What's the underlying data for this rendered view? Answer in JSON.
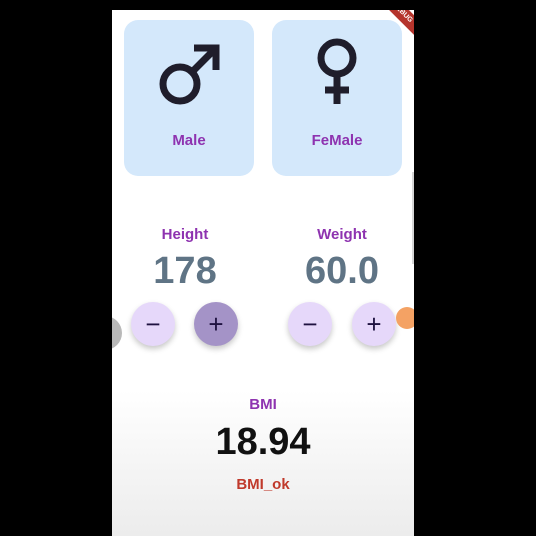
{
  "debug_banner": "DEBUG",
  "gender": {
    "male_label": "Male",
    "female_label": "FeMale"
  },
  "height": {
    "label": "Height",
    "value": "178"
  },
  "weight": {
    "label": "Weight",
    "value": "60.0"
  },
  "controls": {
    "minus_glyph": "−",
    "plus_glyph": "+"
  },
  "bmi": {
    "label": "BMI",
    "value": "18.94",
    "status": "BMI_ok"
  },
  "colors": {
    "card_bg": "#d4e8fb",
    "accent_purple": "#8e33b0",
    "value_slate": "#5f7485",
    "status_red": "#c0392b",
    "button_bg": "#e6d8fa",
    "button_pressed": "#a493c7"
  },
  "icons": {
    "male": "male-symbol-icon",
    "female": "female-symbol-icon"
  }
}
